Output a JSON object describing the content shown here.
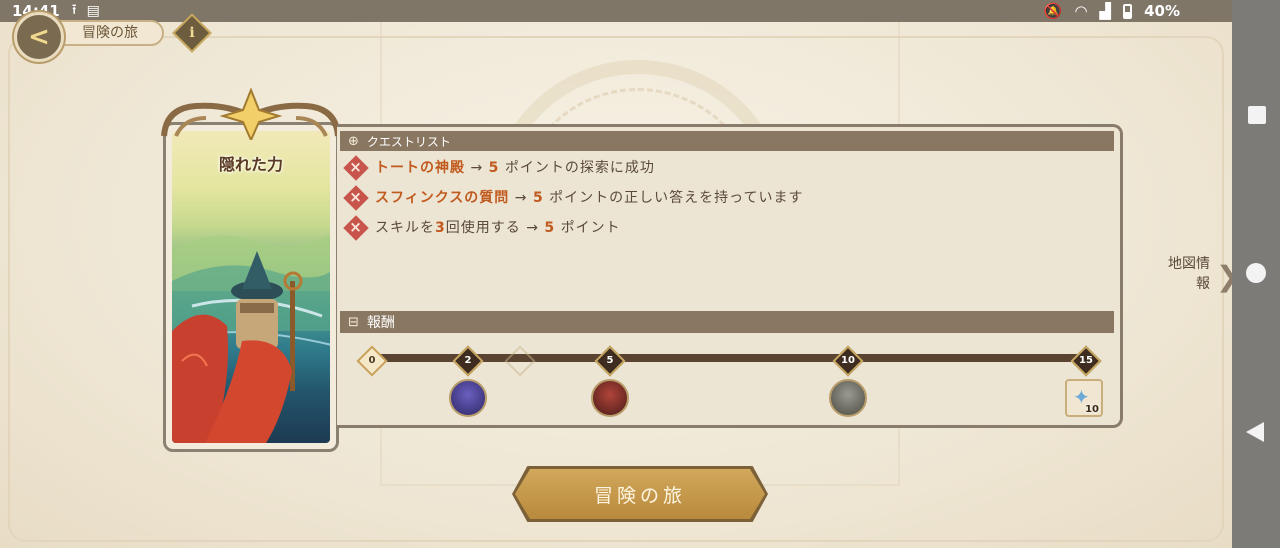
{
  "status_bar": {
    "time": "14:41",
    "battery": "40%"
  },
  "header": {
    "title": "冒険の旅",
    "info_label": "i"
  },
  "card": {
    "title": "隠れた力"
  },
  "quest_list": {
    "heading": "クエストリスト",
    "items": [
      {
        "target": "トートの神殿",
        "arrow": " → ",
        "points": "5",
        "rest": " ポイントの探索に成功"
      },
      {
        "target": "スフィンクスの質問",
        "arrow": " → ",
        "points": "5",
        "rest": " ポイントの正しい答えを持っています"
      },
      {
        "pre": "スキルを",
        "count": "3",
        "mid": "回使用する",
        "arrow": " → ",
        "points": "5",
        "rest": " ポイント"
      }
    ]
  },
  "rewards": {
    "heading": "報酬",
    "milestones": [
      "0",
      "2",
      "5",
      "10",
      "15"
    ],
    "progress": 0,
    "item_quantity": "10"
  },
  "map_info": {
    "label_line1": "地図情",
    "label_line2": "報"
  },
  "adventure_button": {
    "label": "冒険の旅"
  },
  "colors": {
    "accent": "#c15a1e",
    "panel_header": "#8a7762",
    "button_gold": "#c69a4c"
  }
}
